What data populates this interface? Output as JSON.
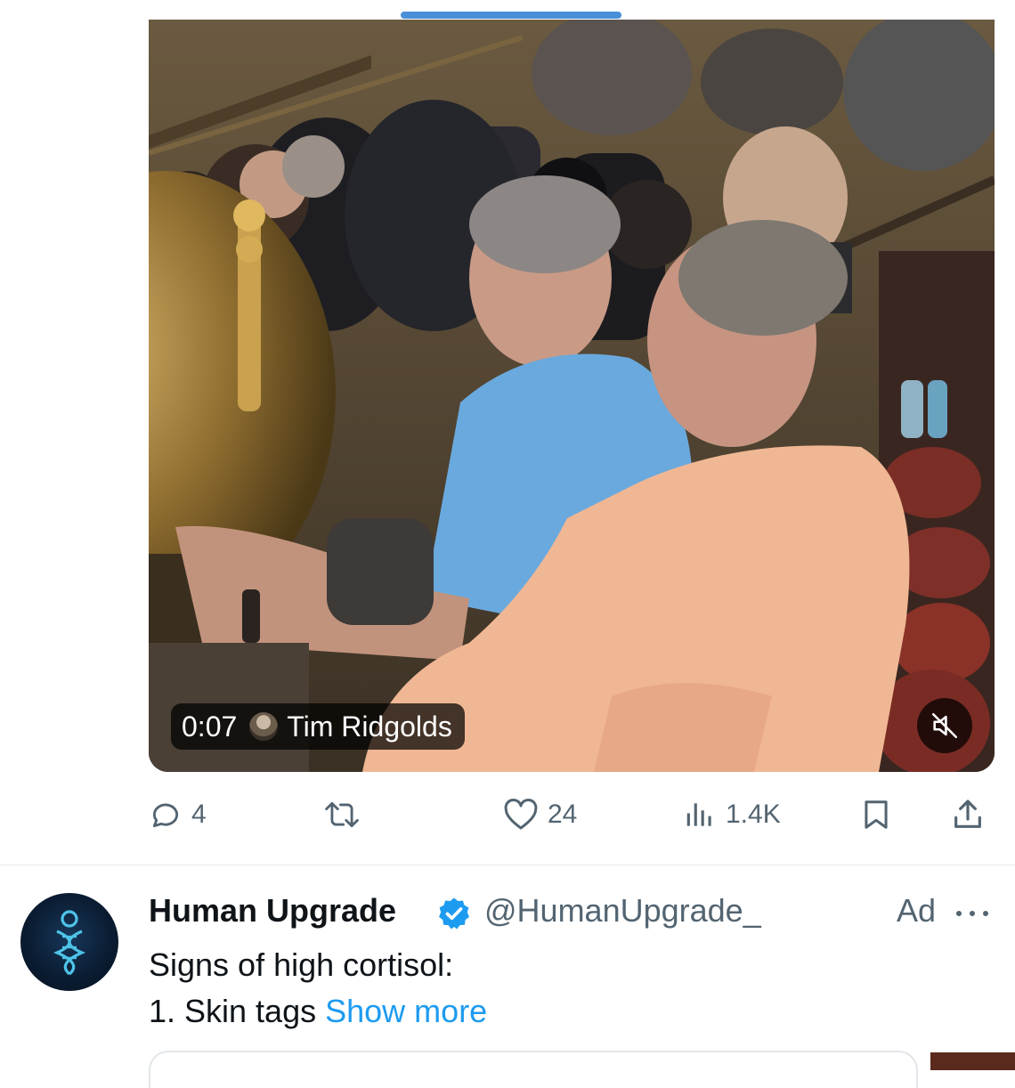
{
  "video": {
    "duration": "0:07",
    "author": "Tim Ridgolds",
    "muted": true
  },
  "actions": {
    "replies": "4",
    "retweets": "",
    "likes": "24",
    "views": "1.4K"
  },
  "ad_tweet": {
    "display_name": "Human Upgrade",
    "handle": "@HumanUpgrade_",
    "ad_label": "Ad",
    "text_line1": "Signs of high cortisol:",
    "text_line2": "1. Skin tags",
    "show_more": "Show more",
    "verified": true
  },
  "colors": {
    "accent": "#1d9bf0",
    "secondary_text": "#536471",
    "primary_text": "#0f1419"
  }
}
